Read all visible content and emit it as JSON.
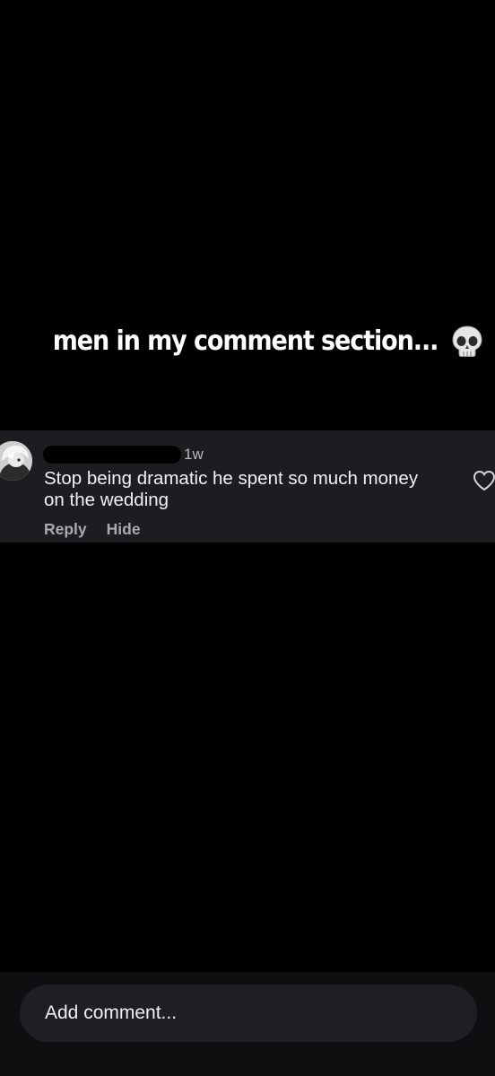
{
  "story": {
    "caption": "men in my comment section..."
  },
  "comment": {
    "timestamp": "1w",
    "text": "Stop being dramatic he spent so much money on the wedding",
    "reply_label": "Reply",
    "hide_label": "Hide"
  },
  "composer": {
    "placeholder": "Add comment..."
  },
  "icons": {
    "caption_emoji": "skull-icon",
    "like": "heart-outline-icon"
  },
  "colors": {
    "background": "#000000",
    "comment_card": "#1c1c21",
    "composer_bar": "#0e0f11",
    "composer_field": "#1d1f24",
    "muted_text": "#a9a9b2"
  }
}
